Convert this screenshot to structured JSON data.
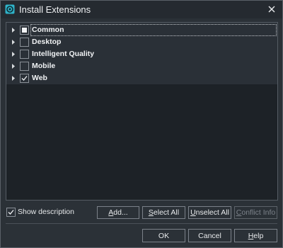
{
  "window": {
    "title": "Install Extensions",
    "accent": "#2fb3c9"
  },
  "tree": {
    "items": [
      {
        "label": "Common",
        "state": "partial",
        "selected": true
      },
      {
        "label": "Desktop",
        "state": "unchecked",
        "selected": false
      },
      {
        "label": "Intelligent Quality",
        "state": "unchecked",
        "selected": false
      },
      {
        "label": "Mobile",
        "state": "unchecked",
        "selected": false
      },
      {
        "label": "Web",
        "state": "checked",
        "selected": false
      }
    ]
  },
  "options": {
    "show_description_label": "Show description",
    "show_description_checked": true
  },
  "actions": {
    "add": {
      "mnemonic": "A",
      "rest": "dd..."
    },
    "select_all": {
      "mnemonic": "S",
      "rest": "elect All"
    },
    "unselect_all": {
      "mnemonic": "U",
      "rest": "nselect All"
    },
    "conflict_info": {
      "mnemonic": "C",
      "rest": "onflict Info"
    }
  },
  "footer": {
    "ok": "OK",
    "cancel": "Cancel",
    "help": {
      "mnemonic": "H",
      "rest": "elp"
    }
  }
}
